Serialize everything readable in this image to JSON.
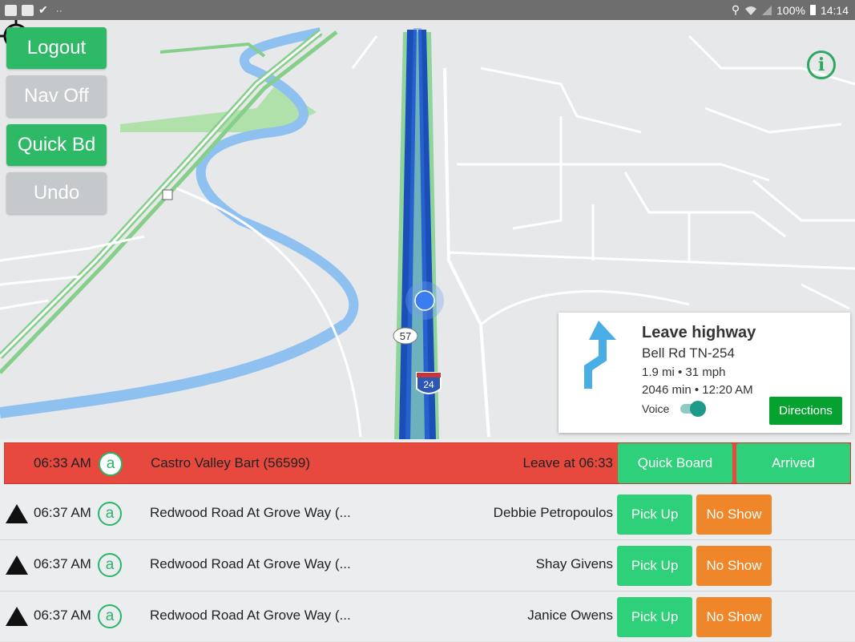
{
  "status_bar": {
    "left_icons": [
      "map-icon",
      "image-icon",
      "checkmark-icon"
    ],
    "dots": "··",
    "location_icon": "location-pin-icon",
    "wifi_icon": "wifi-icon",
    "signal_icon": "signal-icon",
    "battery_text": "100%",
    "battery_icon": "battery-icon",
    "time": "14:14"
  },
  "side_buttons": {
    "logout": "Logout",
    "nav_off": "Nav Off",
    "quick_bd": "Quick Bd",
    "undo": "Undo"
  },
  "map": {
    "route_shield_57": "57",
    "interstate_shield": "24",
    "info_icon_glyph": "i"
  },
  "nav_card": {
    "title": "Leave highway",
    "road": "Bell Rd TN-254",
    "distance_speed": "1.9 mi • 31 mph",
    "eta": "2046 min • 12:20 AM",
    "voice_label": "Voice",
    "voice_on": true,
    "directions_button": "Directions"
  },
  "trips": [
    {
      "time": "06:33 AM",
      "badge": "a",
      "location": "Castro Valley Bart (56599)",
      "passenger": "Leave at  06:33",
      "primary_action": "Quick Board",
      "secondary_action": "Arrived",
      "active": true
    },
    {
      "time": "06:37 AM",
      "badge": "a",
      "location": "Redwood Road At Grove Way (...",
      "passenger": "Debbie Petropoulos",
      "primary_action": "Pick Up",
      "secondary_action": "No Show",
      "active": false
    },
    {
      "time": "06:37 AM",
      "badge": "a",
      "location": "Redwood Road At Grove Way (...",
      "passenger": "Shay Givens",
      "primary_action": "Pick Up",
      "secondary_action": "No Show",
      "active": false
    },
    {
      "time": "06:37 AM",
      "badge": "a",
      "location": "Redwood Road At Grove Way (...",
      "passenger": "Janice Owens",
      "primary_action": "Pick Up",
      "secondary_action": "No Show",
      "active": false
    }
  ],
  "colors": {
    "active_row": "#e8493e",
    "action_green": "#2fd07a",
    "no_show_orange": "#f0862a",
    "side_green": "#2db965",
    "side_grey": "#c6c9cc",
    "route_blue": "#1f5bc6"
  }
}
